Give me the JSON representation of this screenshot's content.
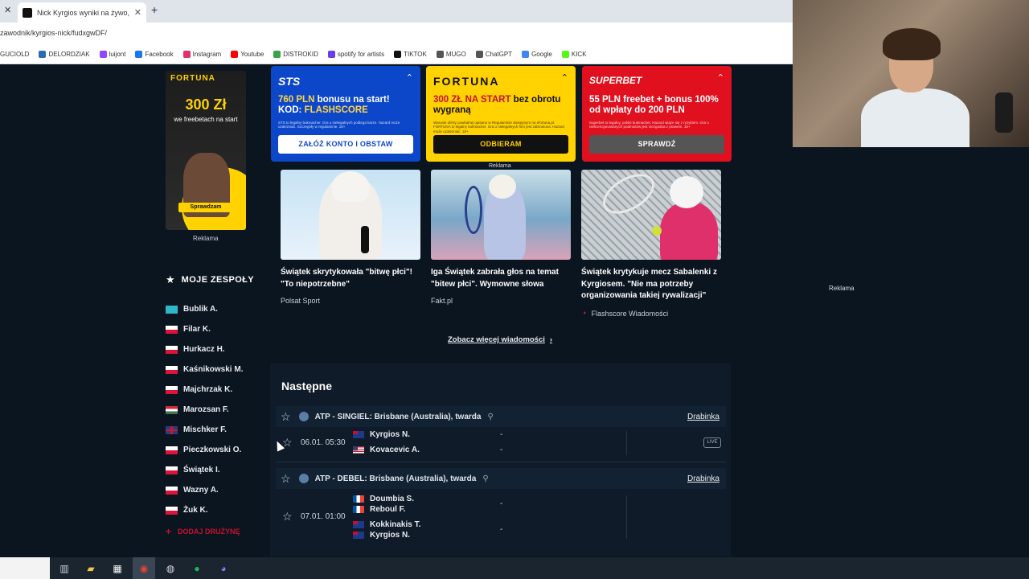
{
  "browser": {
    "tab_title": "Nick Kyrgios wyniki na żywo, m",
    "url": "zawodnik/kyrgios-nick/fudxgwDF/",
    "bookmarks": [
      {
        "label": "GUCIOLD",
        "color": "#444"
      },
      {
        "label": "DELORDZIAK",
        "color": "#2b6cb0"
      },
      {
        "label": "luijont",
        "color": "#9146ff"
      },
      {
        "label": "Facebook",
        "color": "#1877f2"
      },
      {
        "label": "Instagram",
        "color": "#e1306c"
      },
      {
        "label": "Youtube",
        "color": "#ff0000"
      },
      {
        "label": "DISTROKID",
        "color": "#3aa24a"
      },
      {
        "label": "spotify for artists",
        "color": "#6a3de8"
      },
      {
        "label": "TIKTOK",
        "color": "#111"
      },
      {
        "label": "MUGO",
        "color": "#555"
      },
      {
        "label": "ChatGPT",
        "color": "#555"
      },
      {
        "label": "Google",
        "color": "#4285f4"
      },
      {
        "label": "KICK",
        "color": "#53fc18"
      }
    ]
  },
  "left_ad": {
    "brand": "FORTUNA",
    "amount": "300 Zł",
    "subtitle": "we freebetach na start",
    "cta": "Sprawdzam",
    "label": "Reklama"
  },
  "teams": {
    "header": "MOJE ZESPOŁY",
    "items": [
      {
        "name": "Bublik A.",
        "flag": "kz"
      },
      {
        "name": "Filar K.",
        "flag": "pl"
      },
      {
        "name": "Hurkacz H.",
        "flag": "pl"
      },
      {
        "name": "Kaśnikowski M.",
        "flag": "pl"
      },
      {
        "name": "Majchrzak K.",
        "flag": "pl"
      },
      {
        "name": "Marozsan F.",
        "flag": "hu"
      },
      {
        "name": "Mischker F.",
        "flag": "gb"
      },
      {
        "name": "Pieczkowski O.",
        "flag": "pl"
      },
      {
        "name": "Świątek I.",
        "flag": "pl"
      },
      {
        "name": "Wazny A.",
        "flag": "pl"
      },
      {
        "name": "Żuk K.",
        "flag": "pl"
      }
    ],
    "add_label": "DODAJ DRUŻYNĘ"
  },
  "promos": {
    "sts": {
      "logo": "STS",
      "headline_a": "760 PLN",
      "headline_b": " bonusu na start!",
      "headline_c": "KOD: ",
      "headline_d": "FLASHSCORE",
      "fine": "STS to legalny bukmacher. Gra u nielegalnych podlega karze. Hazard może uzależniać. Szczegóły w regulaminie. 18+",
      "cta": "ZAŁÓŻ KONTO I OBSTAW"
    },
    "fortuna": {
      "logo": "FORTUNA",
      "headline_a": "300 ZŁ NA START",
      "headline_b": " bez obrotu wygraną",
      "fine": "Warunki oferty powitalnej opisano w Regulaminie dostępnym na efortuna.pl. FORTUNA to legalny bukmacher. Gra u nielegalnych firm jest zabroniona. Hazard może uzależniać. 18+",
      "cta": "ODBIERAM"
    },
    "superbet": {
      "logo": "SUPERBET",
      "headline": "55 PLN freebet + bonus 100% od wpłaty do 200 PLN",
      "fine": "Superbet to legalny, polski bukmacher. Hazard wiąże się z ryzykiem. Gra u nielicencjonowanych podmiotów jest niezgodna z prawem. 18+",
      "cta": "SPRAWDŹ"
    },
    "label": "Reklama"
  },
  "news": [
    {
      "title": "Świątek skrytykowała \"bitwę płci\"! \"To niepotrzebne\"",
      "source": "Polsat Sport"
    },
    {
      "title": "Iga Świątek zabrała głos na temat \"bitew płci\". Wymowne słowa",
      "source": "Fakt.pl"
    },
    {
      "title": "Świątek krytykuje mecz Sabalenki z Kyrgiosem. \"Nie ma potrzeby organizowania takiej rywalizacji\"",
      "source": "Flashscore Wiadomości"
    }
  ],
  "more_news": "Zobacz więcej wiadomości",
  "next": {
    "title": "Następne",
    "leagues": [
      {
        "name": "ATP - SINGIEL: Brisbane (Australia), twarda",
        "draw_label": "Drabinka",
        "match": {
          "time": "06.01. 05:30",
          "p1": "Kyrgios N.",
          "p2": "Kovacevic A.",
          "s1": "-",
          "s2": "-",
          "live": "LIVE"
        }
      },
      {
        "name": "ATP - DEBEL: Brisbane (Australia), twarda",
        "draw_label": "Drabinka",
        "match": {
          "time": "07.01. 01:00",
          "p1a": "Doumbia S.",
          "p1b": "Reboul F.",
          "p2a": "Kokkinakis T.",
          "p2b": "Kyrgios N.",
          "s1": "-",
          "s2": "-"
        }
      }
    ]
  },
  "right_ad_label": "Reklama"
}
